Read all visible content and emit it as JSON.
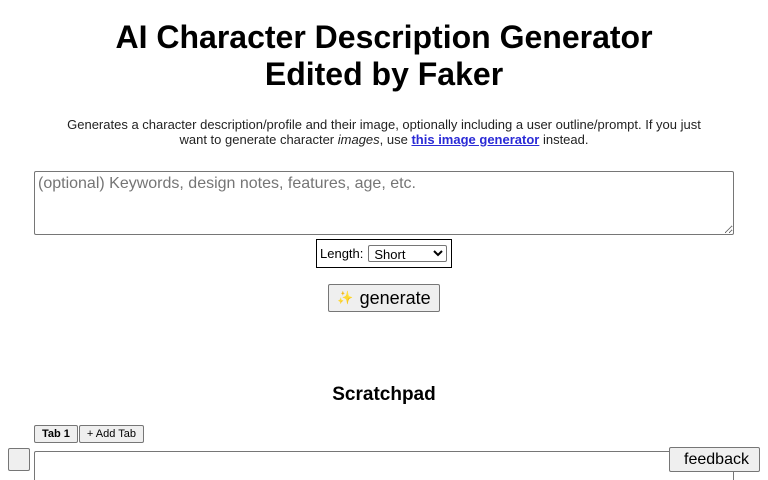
{
  "header": {
    "title_line1": "AI Character Description Generator",
    "title_line2": "Edited by Faker"
  },
  "description": {
    "text_before": "Generates a character description/profile and their image, optionally including a user outline/prompt. If you just want to generate character ",
    "emphasis": "images",
    "text_middle": ", use ",
    "link_text": "this image generator",
    "text_after": " instead."
  },
  "prompt": {
    "placeholder": "(optional) Keywords, design notes, features, age, etc.",
    "value": ""
  },
  "length": {
    "label": "Length:",
    "selected": "Short",
    "options": [
      "Short"
    ]
  },
  "generate_button": {
    "icon": "sparkles-icon",
    "label": "generate"
  },
  "scratchpad": {
    "title": "Scratchpad",
    "tabs": [
      {
        "label": "Tab 1",
        "active": true
      }
    ],
    "add_tab_label": "+ Add Tab"
  },
  "corner_button": {
    "icon": "missing-glyph-icon",
    "glyph": ""
  },
  "feedback_button": {
    "icon": "missing-glyph-icon",
    "glyph": "",
    "label": "feedback"
  },
  "colors": {
    "link": "#2a2ad6",
    "button_bg": "#efefef",
    "border": "#767676"
  }
}
